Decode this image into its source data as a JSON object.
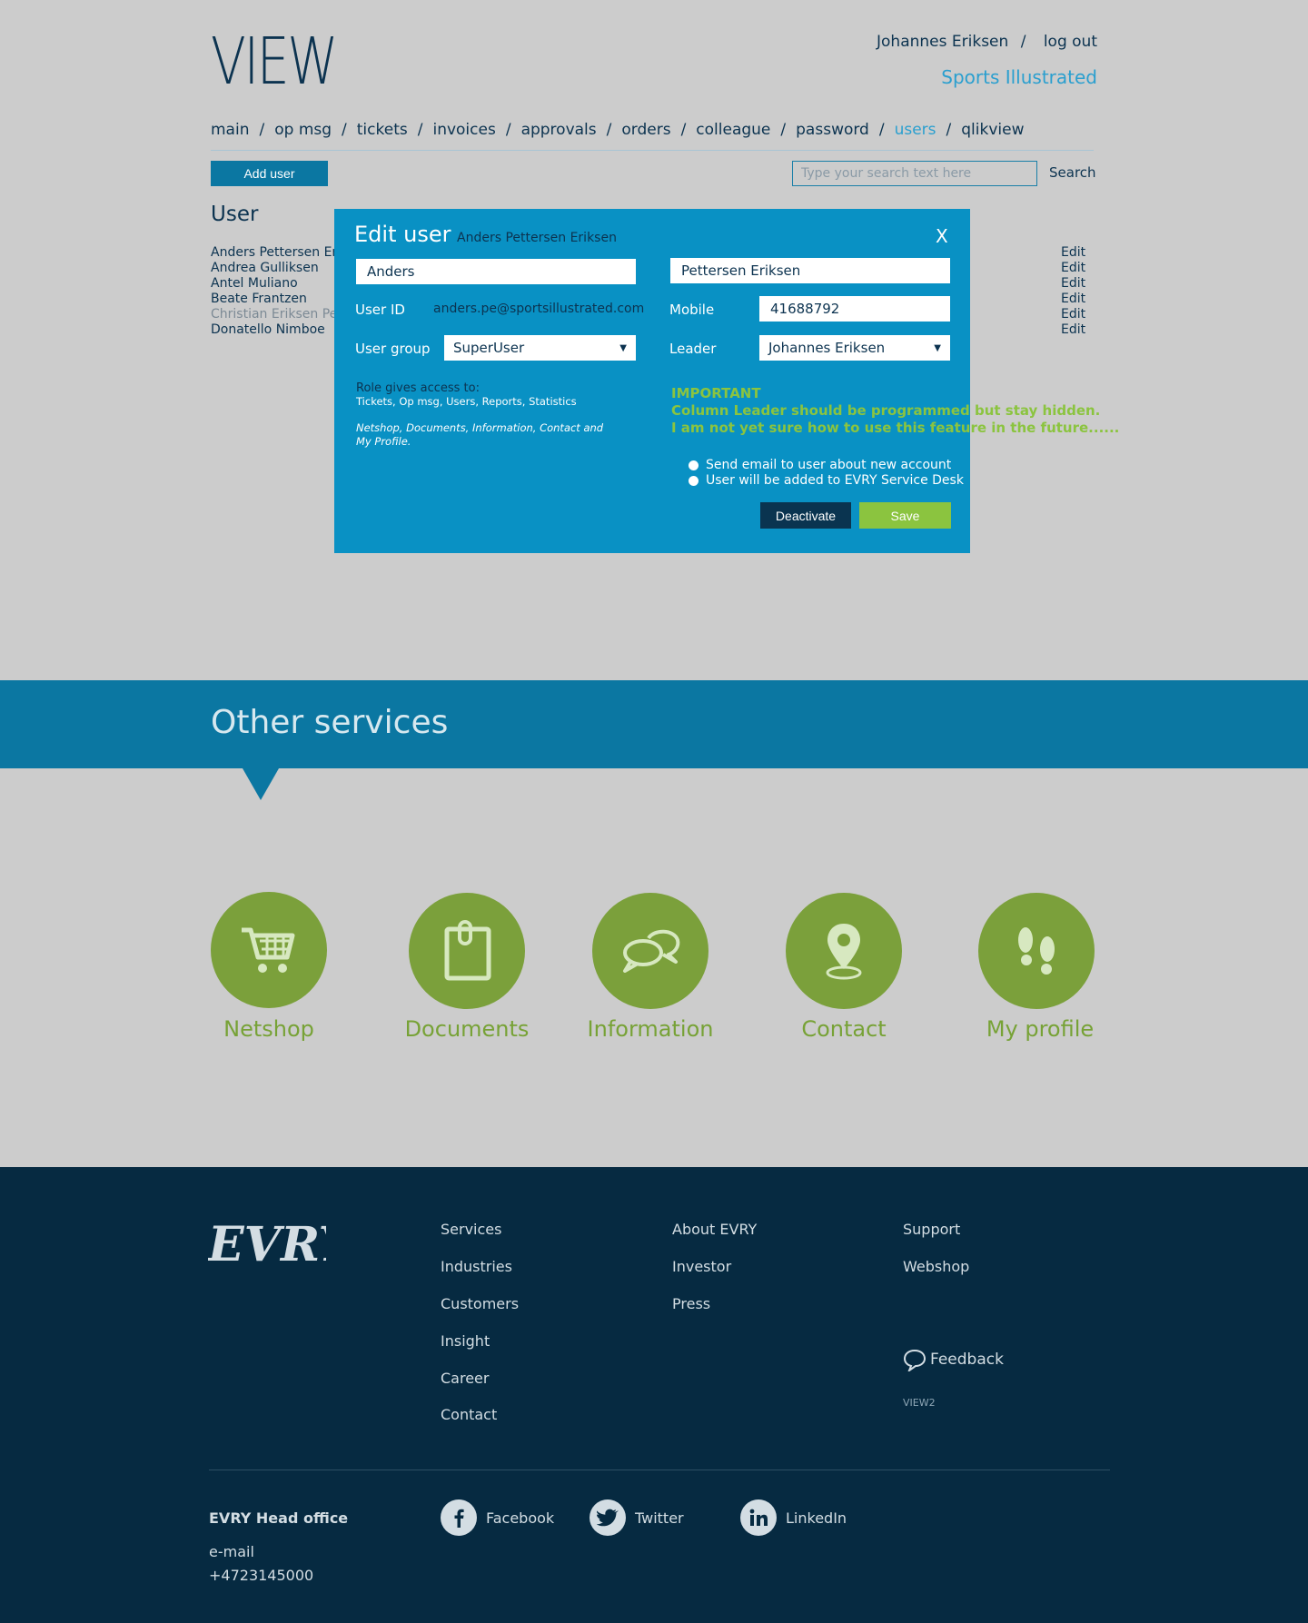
{
  "header": {
    "logo": "VIEW",
    "user_name": "Johannes Eriksen",
    "separator": "/",
    "logout": "log out",
    "company": "Sports Illustrated"
  },
  "nav": {
    "items": [
      "main",
      "op msg",
      "tickets",
      "invoices",
      "approvals",
      "orders",
      "colleague",
      "password",
      "users",
      "qlikview"
    ],
    "active": "users",
    "separator": "/"
  },
  "toolbar": {
    "add_user": "Add user",
    "search_placeholder": "Type your search text here",
    "search_label": "Search"
  },
  "users_section": {
    "title": "User",
    "users": [
      "Anders Pettersen Eriksen",
      "Andrea Gulliksen",
      "Antel Muliano",
      "Beate Frantzen",
      "Christian Eriksen Pedersen",
      "Donatello Nimboe"
    ],
    "edit_label": "Edit"
  },
  "modal": {
    "title": "Edit user",
    "subtitle": "Anders Pettersen Eriksen",
    "close": "X",
    "first_name": "Anders",
    "last_name": "Pettersen Eriksen",
    "user_id_label": "User ID",
    "user_id_value": "anders.pe@sportsillustrated.com",
    "mobile_label": "Mobile",
    "mobile_value": "41688792",
    "user_group_label": "User group",
    "user_group_value": "SuperUser",
    "leader_label": "Leader",
    "leader_value": "Johannes Eriksen",
    "role_title": "Role gives access to:",
    "role_access": "Tickets, Op msg, Users, Reports, Statistics",
    "role_italic": "Netshop, Documents, Information, Contact and My Profile.",
    "important_title": "IMPORTANT",
    "important_line1": "Column Leader should be programmed but stay hidden.",
    "important_line2": "I am not yet sure how to use this feature in the future......",
    "option_email": "Send email to user about new account",
    "option_servicedesk": "User will be added to EVRY Service Desk",
    "deactivate": "Deactivate",
    "save": "Save"
  },
  "other_services": {
    "title": "Other services",
    "items": [
      {
        "label": "Netshop",
        "icon": "cart-icon"
      },
      {
        "label": "Documents",
        "icon": "clipboard-icon"
      },
      {
        "label": "Information",
        "icon": "chat-bubbles-icon"
      },
      {
        "label": "Contact",
        "icon": "location-pin-icon"
      },
      {
        "label": "My profile",
        "icon": "footprints-icon"
      }
    ]
  },
  "footer": {
    "logo": "EVRY",
    "col1": [
      "Services",
      "Industries",
      "Customers",
      "Insight",
      "Career",
      "Contact"
    ],
    "col2": [
      "About EVRY",
      "Investor",
      "Press"
    ],
    "col3": [
      "Support",
      "Webshop"
    ],
    "feedback": "Feedback",
    "version": "VIEW2",
    "head_office": "EVRY Head office",
    "email": "e-mail",
    "phone": "+4723145000",
    "social": {
      "facebook": "Facebook",
      "twitter": "Twitter",
      "linkedin": "LinkedIn"
    }
  },
  "colors": {
    "background": "#cccccc",
    "navy": "#0c3350",
    "accent_blue": "#2a9fcf",
    "modal_blue": "#0991c4",
    "band_blue": "#0b77a2",
    "green": "#7ba03b",
    "lime": "#8bc43f",
    "footer": "#062a41"
  }
}
